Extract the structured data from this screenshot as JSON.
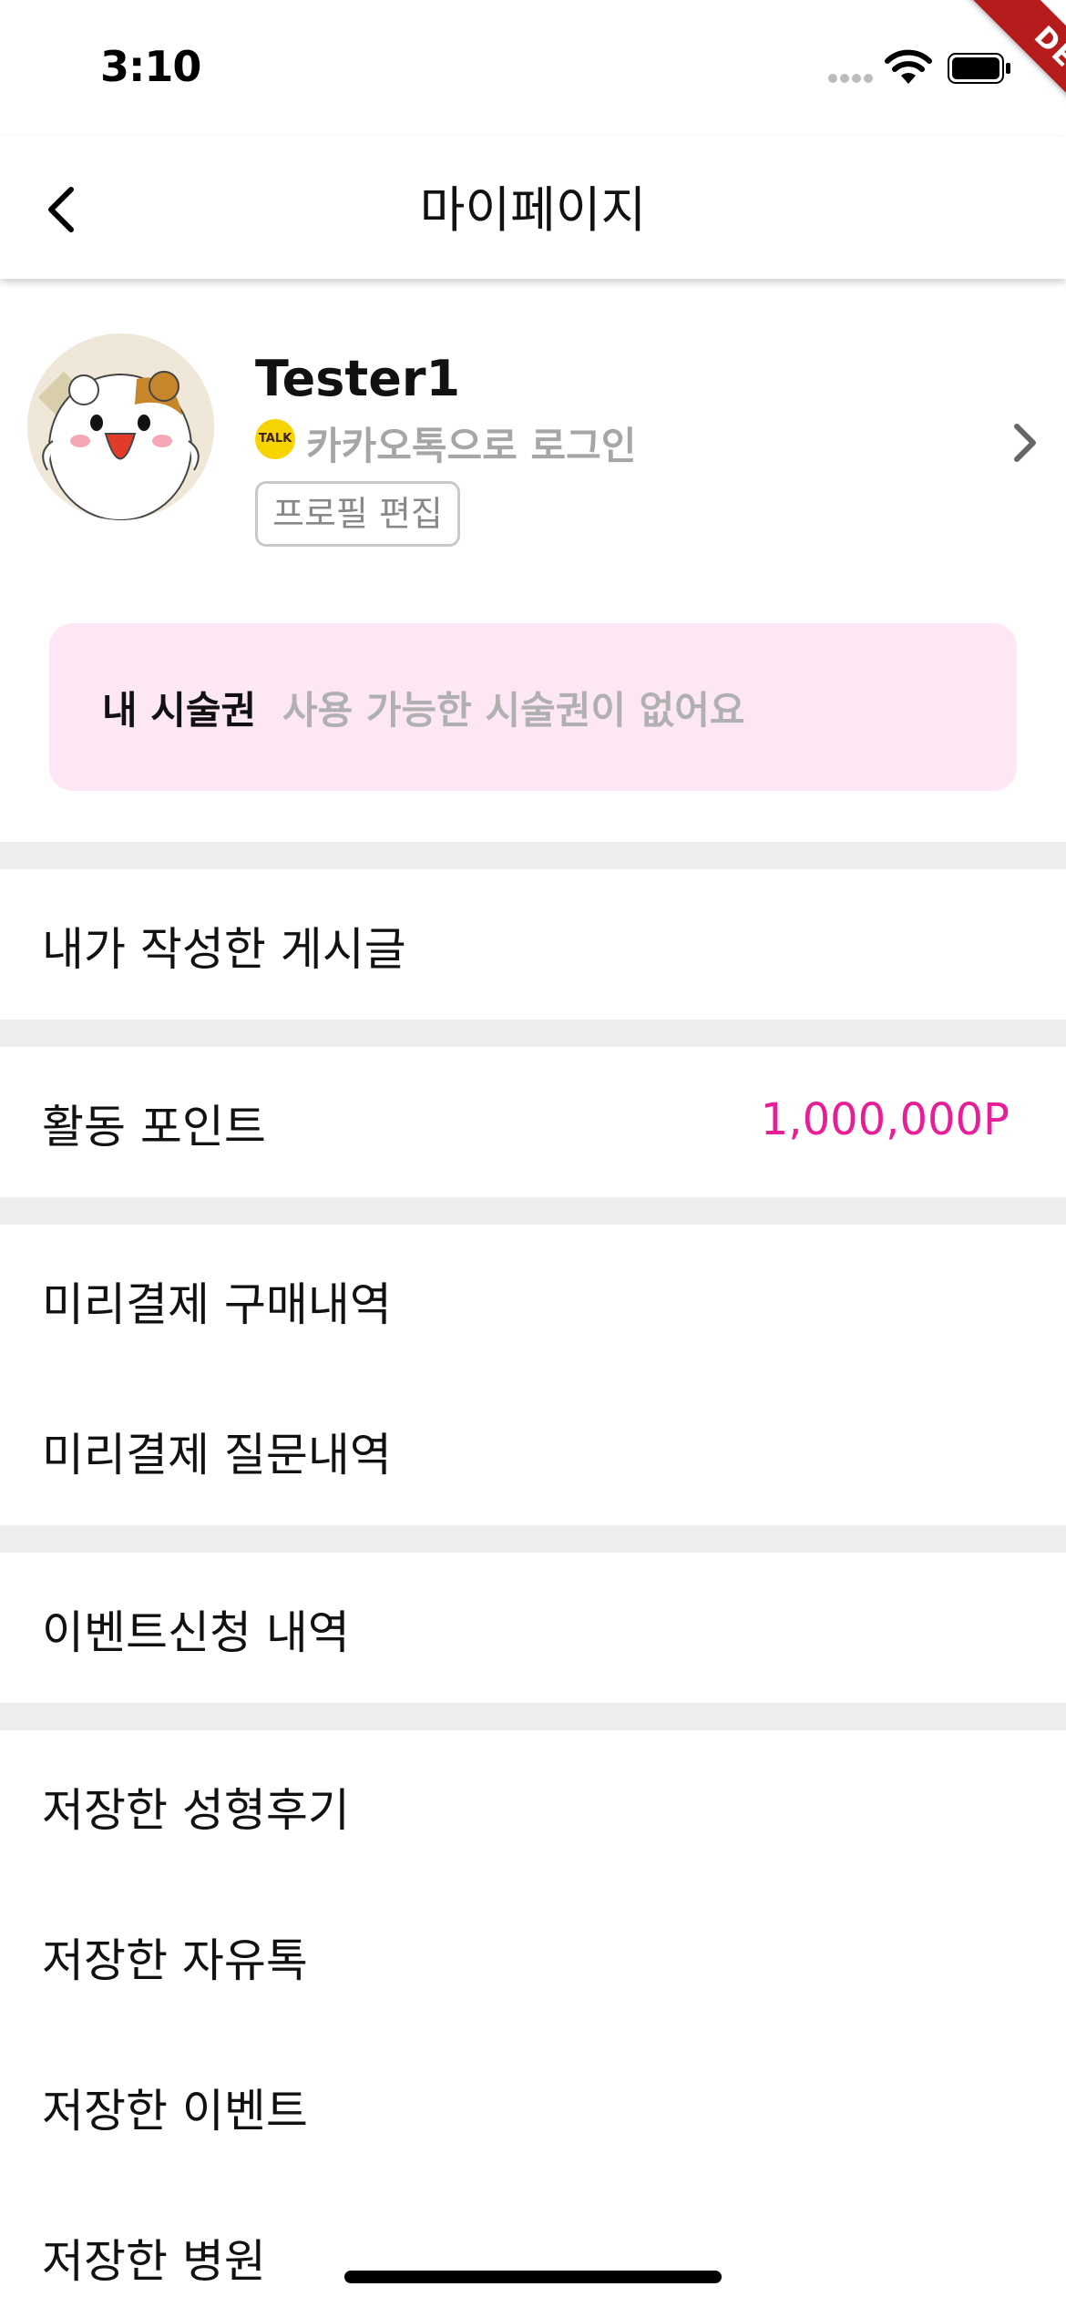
{
  "status_bar": {
    "time": "3:10",
    "debug_label": "DEBUG"
  },
  "app_bar": {
    "title": "마이페이지"
  },
  "profile": {
    "name": "Tester1",
    "login_method": "카카오톡으로 로그인",
    "kakao_badge": "TALK",
    "edit_button_label": "프로필 편집"
  },
  "coupon": {
    "label": "내 시술권",
    "value": "사용 가능한 시술권이 없어요"
  },
  "menu": {
    "my_posts": "내가 작성한 게시글",
    "activity_points": {
      "label": "활동 포인트",
      "value": "1,000,000P"
    },
    "prepay_purchase_history": "미리결제 구매내역",
    "prepay_question_history": "미리결제 질문내역",
    "event_application_history": "이벤트신청 내역",
    "saved_reviews": "저장한 성형후기",
    "saved_free_talk": "저장한 자유톡",
    "saved_events": "저장한 이벤트",
    "saved_hospitals": "저장한 병원"
  },
  "colors": {
    "accent": "#e61e98",
    "coupon_bg": "#fde7f4",
    "divider": "#eeeeee",
    "kakao_yellow": "#f7d400"
  },
  "icons": {
    "back": "chevron-left-icon",
    "profile_arrow": "chevron-right-icon",
    "kakao": "kakao-talk-icon"
  }
}
